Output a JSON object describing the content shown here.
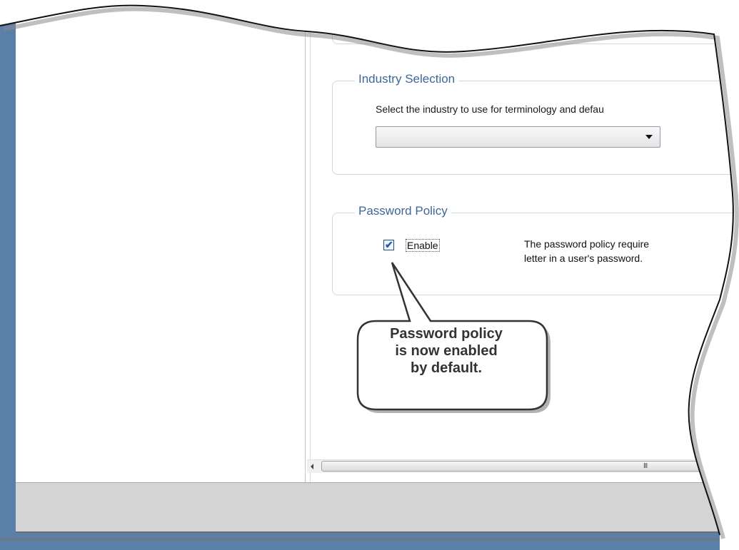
{
  "industry_selection": {
    "title": "Industry Selection",
    "description": "Select the industry to use for terminology and defau",
    "dropdown_value": ""
  },
  "password_policy": {
    "title": "Password Policy",
    "enable_label": "Enable",
    "enable_checked": true,
    "description_line1": "The password policy require",
    "description_line2": "letter in a user's password."
  },
  "scrollbar": {
    "grip": "III"
  },
  "callout": {
    "line1": "Password policy",
    "line2": "is now enabled",
    "line3": "by default."
  },
  "colors": {
    "frame": "#5a7fa8",
    "group_title": "#3e6796",
    "status_bar": "#d4d4d4"
  }
}
